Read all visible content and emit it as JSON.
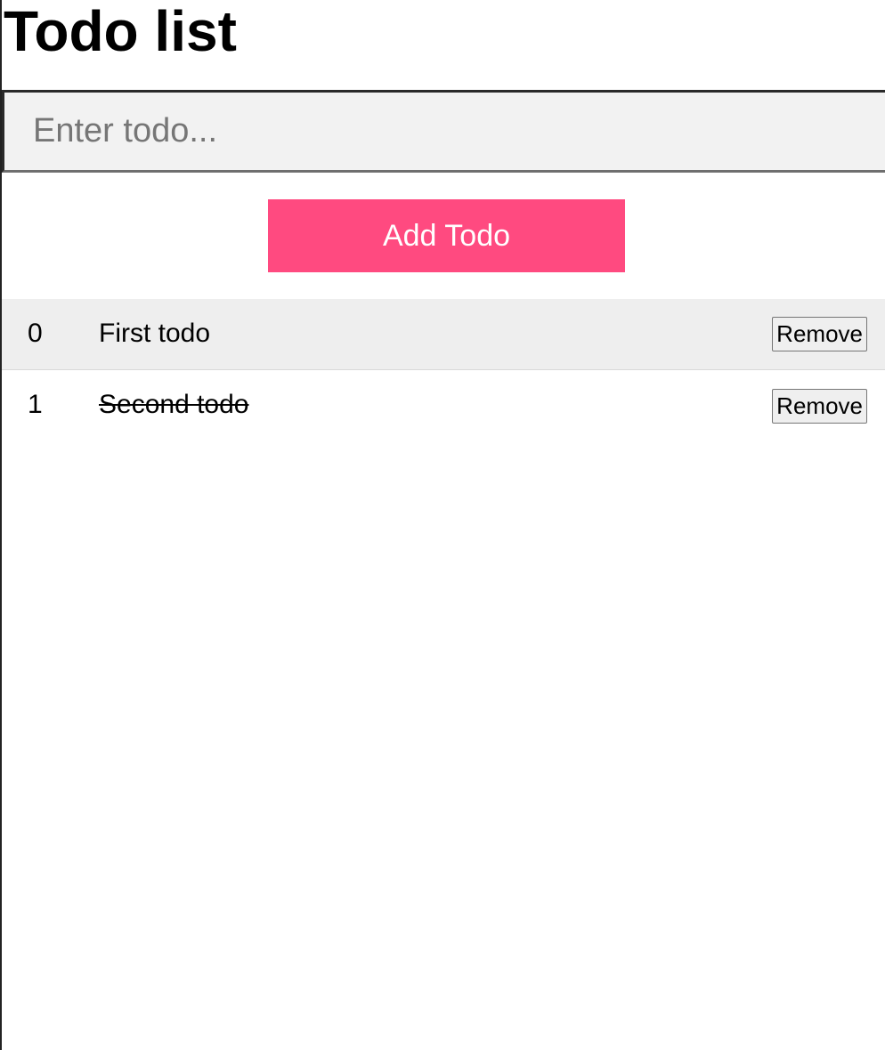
{
  "header": {
    "title": "Todo list"
  },
  "form": {
    "input_placeholder": "Enter todo...",
    "input_value": "",
    "add_button_label": "Add Todo"
  },
  "colors": {
    "accent": "#ff4a80",
    "row_highlight": "#eeeeee"
  },
  "todos": [
    {
      "index": "0",
      "text": "First todo",
      "completed": false,
      "remove_label": "Remove"
    },
    {
      "index": "1",
      "text": "Second todo",
      "completed": true,
      "remove_label": "Remove"
    }
  ]
}
